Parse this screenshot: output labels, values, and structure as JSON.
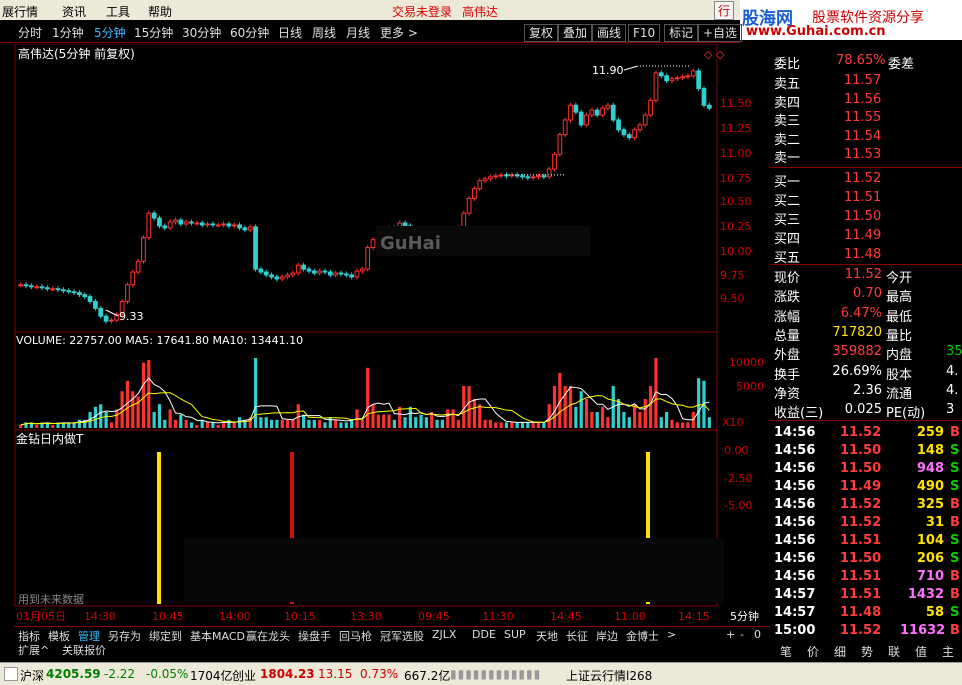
{
  "menu": {
    "items": [
      "展行情",
      "资讯",
      "工具",
      "帮助"
    ],
    "login_status": "交易未登录",
    "stock_name": "高伟达",
    "trade_btn": "行"
  },
  "brand": {
    "name": "股海网",
    "slogan": "股票软件资源分享",
    "url": "www.Guhai.com.cn"
  },
  "periods": [
    "分时",
    "1分钟",
    "5分钟",
    "15分钟",
    "30分钟",
    "60分钟",
    "日线",
    "周线",
    "月线",
    "更多 >"
  ],
  "active_period": "5分钟",
  "tools": [
    "复权",
    "叠加",
    "画线",
    "F10",
    "标记",
    "+自选"
  ],
  "chart": {
    "title": "高伟达(5分钟 前复权)",
    "price_labels": [
      "11.50",
      "11.25",
      "11.00",
      "10.75",
      "10.50",
      "10.25",
      "10.00",
      "9.75",
      "9.50"
    ],
    "high_label": "11.90",
    "low_label": "9.33",
    "watermark": "GuHai",
    "volume_header": "VOLUME: 22757.00  MA5: 17641.80  MA10: 13441.10",
    "vol_labels": [
      "10000",
      "5000"
    ],
    "vol_unit": "X10",
    "indicator_title": "金钻日内做T",
    "ind_labels": [
      "0.00",
      "-2.50",
      "-5.00"
    ],
    "future_note": "用到未来数据",
    "time_labels": [
      "01月05日",
      "14:30",
      "10:45",
      "14:00",
      "10:15",
      "13:30",
      "09:45",
      "11:30",
      "14:45",
      "11:00",
      "14:15"
    ],
    "period_label": "5分钟",
    "colors": {
      "up": "#ff3030",
      "down": "#30d0d0",
      "grid": "#800000",
      "ma5": "#ffffff",
      "ma10": "#ffff00"
    }
  },
  "chart_data": {
    "type": "candlestick",
    "unit": "price",
    "ylim": [
      9.3,
      11.95
    ],
    "closes": [
      9.72,
      9.71,
      9.7,
      9.7,
      9.69,
      9.68,
      9.68,
      9.67,
      9.66,
      9.65,
      9.64,
      9.62,
      9.6,
      9.55,
      9.48,
      9.4,
      9.35,
      9.36,
      9.42,
      9.55,
      9.72,
      9.85,
      9.96,
      10.2,
      10.45,
      10.4,
      10.32,
      10.3,
      10.36,
      10.38,
      10.34,
      10.36,
      10.35,
      10.35,
      10.33,
      10.34,
      10.33,
      10.33,
      10.34,
      10.32,
      10.33,
      10.3,
      10.28,
      10.31,
      9.88,
      9.85,
      9.82,
      9.8,
      9.78,
      9.8,
      9.82,
      9.84,
      9.92,
      9.88,
      9.86,
      9.84,
      9.86,
      9.85,
      9.82,
      9.84,
      9.83,
      9.82,
      9.8,
      9.86,
      9.88,
      10.1,
      10.18,
      10.22,
      10.26,
      10.3,
      10.28,
      10.35,
      10.32,
      10.25,
      10.22,
      10.18,
      10.15,
      10.2,
      10.18,
      10.16,
      10.22,
      10.28,
      10.3,
      10.45,
      10.6,
      10.7,
      10.78,
      10.8,
      10.82,
      10.83,
      10.84,
      10.83,
      10.84,
      10.83,
      10.82,
      10.81,
      10.82,
      10.83,
      10.82,
      10.9,
      11.05,
      11.25,
      11.4,
      11.55,
      11.48,
      11.35,
      11.45,
      11.5,
      11.45,
      11.52,
      11.55,
      11.4,
      11.3,
      11.25,
      11.22,
      11.3,
      11.35,
      11.45,
      11.6,
      11.88,
      11.85,
      11.8,
      11.82,
      11.83,
      11.84,
      11.85,
      11.9,
      11.72,
      11.55,
      11.52
    ],
    "volume_ma5_last": 17641.8,
    "volume_ma10_last": 13441.1
  },
  "quote": {
    "weibi_label": "委比",
    "weibi": "78.65%",
    "weicha_label": "委差",
    "asks": [
      {
        "label": "卖五",
        "price": "11.57"
      },
      {
        "label": "卖四",
        "price": "11.56"
      },
      {
        "label": "卖三",
        "price": "11.55"
      },
      {
        "label": "卖二",
        "price": "11.54"
      },
      {
        "label": "卖一",
        "price": "11.53"
      }
    ],
    "bids": [
      {
        "label": "买一",
        "price": "11.52"
      },
      {
        "label": "买二",
        "price": "11.51"
      },
      {
        "label": "买三",
        "price": "11.50"
      },
      {
        "label": "买四",
        "price": "11.49"
      },
      {
        "label": "买五",
        "price": "11.48"
      }
    ],
    "stats": [
      {
        "l1": "现价",
        "v1": "11.52",
        "c1": "red",
        "l2": "今开",
        "v2": "",
        "c2": "wht"
      },
      {
        "l1": "涨跌",
        "v1": "0.70",
        "c1": "red",
        "l2": "最高",
        "v2": "",
        "c2": "wht"
      },
      {
        "l1": "涨幅",
        "v1": "6.47%",
        "c1": "red",
        "l2": "最低",
        "v2": "",
        "c2": "wht"
      },
      {
        "l1": "总量",
        "v1": "717820",
        "c1": "yel",
        "l2": "量比",
        "v2": "",
        "c2": "wht"
      },
      {
        "l1": "外盘",
        "v1": "359882",
        "c1": "red",
        "l2": "内盘",
        "v2": "35",
        "c2": "grn"
      },
      {
        "l1": "换手",
        "v1": "26.69%",
        "c1": "wht",
        "l2": "股本",
        "v2": "4.",
        "c2": "wht"
      },
      {
        "l1": "净资",
        "v1": "2.36",
        "c1": "wht",
        "l2": "流通",
        "v2": "4.",
        "c2": "wht"
      },
      {
        "l1": "收益(三)",
        "v1": "0.025",
        "c1": "wht",
        "l2": "PE(动)",
        "v2": "3",
        "c2": "wht"
      }
    ],
    "ticks": [
      {
        "time": "14:56",
        "price": "11.52",
        "pc": "red",
        "vol": "259",
        "vc": "yel",
        "bs": "B",
        "bc": "red"
      },
      {
        "time": "14:56",
        "price": "11.50",
        "pc": "red",
        "vol": "148",
        "vc": "yel",
        "bs": "S",
        "bc": "grn"
      },
      {
        "time": "14:56",
        "price": "11.50",
        "pc": "red",
        "vol": "948",
        "vc": "mag",
        "bs": "S",
        "bc": "grn"
      },
      {
        "time": "14:56",
        "price": "11.49",
        "pc": "red",
        "vol": "490",
        "vc": "yel",
        "bs": "S",
        "bc": "grn"
      },
      {
        "time": "14:56",
        "price": "11.52",
        "pc": "red",
        "vol": "325",
        "vc": "yel",
        "bs": "B",
        "bc": "red"
      },
      {
        "time": "14:56",
        "price": "11.52",
        "pc": "red",
        "vol": "31",
        "vc": "yel",
        "bs": "B",
        "bc": "red"
      },
      {
        "time": "14:56",
        "price": "11.51",
        "pc": "red",
        "vol": "104",
        "vc": "yel",
        "bs": "S",
        "bc": "grn"
      },
      {
        "time": "14:56",
        "price": "11.50",
        "pc": "red",
        "vol": "206",
        "vc": "yel",
        "bs": "S",
        "bc": "grn"
      },
      {
        "time": "14:56",
        "price": "11.51",
        "pc": "red",
        "vol": "710",
        "vc": "mag",
        "bs": "B",
        "bc": "red"
      },
      {
        "time": "14:57",
        "price": "11.51",
        "pc": "red",
        "vol": "1432",
        "vc": "mag",
        "bs": "B",
        "bc": "red"
      },
      {
        "time": "14:57",
        "price": "11.48",
        "pc": "red",
        "vol": "58",
        "vc": "yel",
        "bs": "S",
        "bc": "grn"
      },
      {
        "time": "15:00",
        "price": "11.52",
        "pc": "red",
        "vol": "11632",
        "vc": "mag",
        "bs": "B",
        "bc": "red"
      }
    ],
    "nav": [
      "笔",
      "价",
      "细",
      "势",
      "联",
      "值",
      "主"
    ]
  },
  "tabs": [
    "指标",
    "模板",
    "管理",
    "另存为",
    "绑定到",
    "基本MACD",
    "赢在龙头",
    "操盘手",
    "回马枪",
    "冠军选股",
    "ZJLX",
    "DDE",
    "SUP",
    "天地",
    "长征",
    "岸边",
    "金博士",
    ">"
  ],
  "active_tab": "管理",
  "tab_controls": [
    "+",
    "-",
    "0"
  ],
  "ext_tabs": [
    "扩展^",
    "关联报价"
  ],
  "status": {
    "sh_name": "沪深",
    "sh_val": "4205.59",
    "sh_chg": "-2.22",
    "sh_pct": "-0.05%",
    "sh_amt": "1704亿",
    "cy_name": "创业",
    "cy_val": "1804.23",
    "cy_chg": "13.15",
    "cy_pct": "0.73%",
    "cy_amt": "667.2亿",
    "feed": "上证云行情l268"
  }
}
